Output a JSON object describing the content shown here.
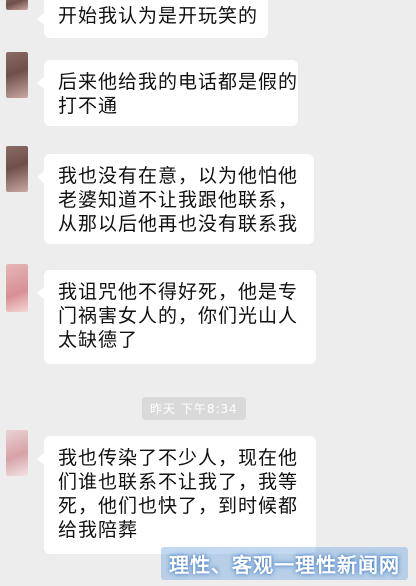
{
  "messages": [
    {
      "lines": [
        "开始我认为是开玩笑的"
      ]
    },
    {
      "lines": [
        "后来他给我的电话都是假的",
        "打不通"
      ]
    },
    {
      "lines": [
        "我也没有在意，以为他怕他",
        "老婆知道不让我跟他联系，",
        "从那以后他再也没有联系我"
      ]
    },
    {
      "lines": [
        "我诅咒他不得好死，他是专",
        "门祸害女人的，你们光山人",
        "太缺德了"
      ]
    },
    {
      "lines": [
        "我也传染了不少人，现在他",
        "们谁也联系不让我了，我等",
        "死，他们也快了，到时候都",
        "给我陪葬"
      ]
    }
  ],
  "timestamp": "昨天 下午8:34",
  "watermark": "理性、客观一理性新闻网"
}
